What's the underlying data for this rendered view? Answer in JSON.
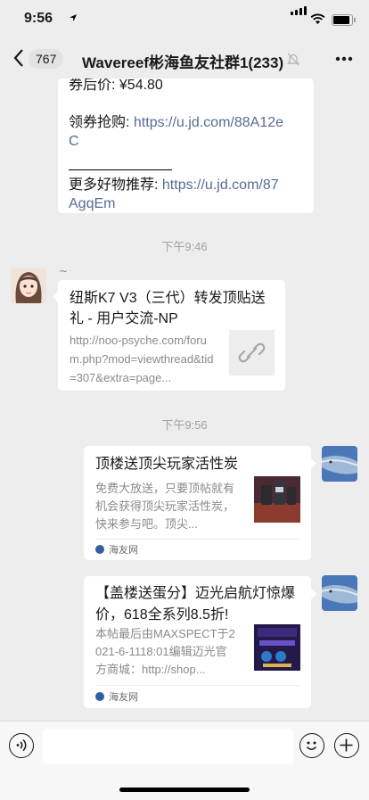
{
  "status_bar": {
    "time": "9:56"
  },
  "nav": {
    "unread_count": "767",
    "title": "Wavereef彬海鱼友社群1(233)"
  },
  "messages": {
    "text_message": {
      "line1_prefix": "券后价: ¥54.80",
      "coupon_label": "领券抢购: ",
      "coupon_link_1": "https://u.jd.com/88A12e",
      "coupon_link_2": "C",
      "more_label": "更多好物推荐: ",
      "more_link_1": "https://u.jd.com/87",
      "more_link_2": "AgqEm"
    },
    "time_1": "下午9:46",
    "sender_nick": "~",
    "link_card": {
      "title": "纽斯K7 V3（三代）转发顶贴送礼 - 用户交流-NP",
      "url": "http://noo-psyche.com/forum.php?mod=viewthread&tid=307&extra=page..."
    },
    "time_2": "下午9:56",
    "share_card_1": {
      "title": "顶楼送顶尖玩家活性炭",
      "desc": "免费大放送，只要顶帖就有机会获得顶尖玩家活性炭，快来参与吧。顶尖...",
      "source": "海友网"
    },
    "share_card_2": {
      "title": "【盖楼送蛋分】迈光启航灯惊爆价，618全系列8.5折!",
      "desc": "本帖最后由MAXSPECT于2021-6-1118:01编辑迈光官方商城：http://shop...",
      "source": "海友网"
    }
  },
  "input_bar": {
    "placeholder": ""
  },
  "colors": {
    "background": "#ededed",
    "link": "#576b95",
    "bubble": "#ffffff"
  }
}
